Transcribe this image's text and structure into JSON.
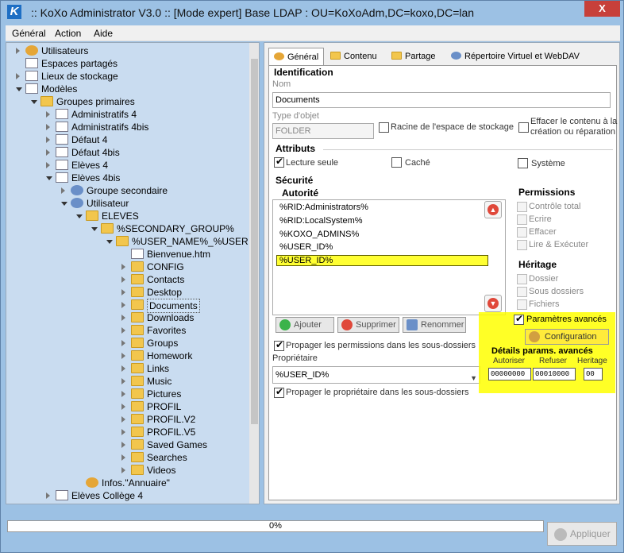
{
  "window": {
    "title": ":: KoXo Administrator V3.0 :: [Mode expert] Base LDAP : OU=KoXoAdm,DC=koxo,DC=lan",
    "close": "X"
  },
  "menu": [
    "Général",
    "Action",
    "Aide"
  ],
  "tree": [
    {
      "label": "Utilisateurs",
      "level": 0,
      "exp": "c",
      "icon": "gear"
    },
    {
      "label": "Espaces partagés",
      "level": 0,
      "exp": "",
      "icon": "doc"
    },
    {
      "label": "Lieux de stockage",
      "level": 0,
      "exp": "c",
      "icon": "doc"
    },
    {
      "label": "Modèles",
      "level": 0,
      "exp": "o",
      "icon": "doc"
    },
    {
      "label": "Groupes primaires",
      "level": 1,
      "exp": "o",
      "icon": "folder"
    },
    {
      "label": "Administratifs 4",
      "level": 2,
      "exp": "c",
      "icon": "doc"
    },
    {
      "label": "Administratifs 4bis",
      "level": 2,
      "exp": "c",
      "icon": "doc"
    },
    {
      "label": "Défaut 4",
      "level": 2,
      "exp": "c",
      "icon": "doc"
    },
    {
      "label": "Défaut 4bis",
      "level": 2,
      "exp": "c",
      "icon": "doc"
    },
    {
      "label": "Elèves 4",
      "level": 2,
      "exp": "c",
      "icon": "doc"
    },
    {
      "label": "Elèves 4bis",
      "level": 2,
      "exp": "o",
      "icon": "doc"
    },
    {
      "label": "Groupe secondaire",
      "level": 3,
      "exp": "c",
      "icon": "user"
    },
    {
      "label": "Utilisateur",
      "level": 3,
      "exp": "o",
      "icon": "user"
    },
    {
      "label": "ELEVES",
      "level": 4,
      "exp": "o",
      "icon": "folder"
    },
    {
      "label": "%SECONDARY_GROUP%",
      "level": 5,
      "exp": "o",
      "icon": "folder"
    },
    {
      "label": "%USER_NAME%_%USER",
      "level": 6,
      "exp": "o",
      "icon": "folder"
    },
    {
      "label": "Bienvenue.htm",
      "level": 7,
      "exp": "",
      "icon": "doc"
    },
    {
      "label": "CONFIG",
      "level": 7,
      "exp": "c",
      "icon": "folder"
    },
    {
      "label": "Contacts",
      "level": 7,
      "exp": "c",
      "icon": "folder"
    },
    {
      "label": "Desktop",
      "level": 7,
      "exp": "c",
      "icon": "folder"
    },
    {
      "label": "Documents",
      "level": 7,
      "exp": "c",
      "icon": "folder",
      "selected": true
    },
    {
      "label": "Downloads",
      "level": 7,
      "exp": "c",
      "icon": "folder"
    },
    {
      "label": "Favorites",
      "level": 7,
      "exp": "c",
      "icon": "folder"
    },
    {
      "label": "Groups",
      "level": 7,
      "exp": "c",
      "icon": "folder"
    },
    {
      "label": "Homework",
      "level": 7,
      "exp": "c",
      "icon": "folder"
    },
    {
      "label": "Links",
      "level": 7,
      "exp": "c",
      "icon": "folder"
    },
    {
      "label": "Music",
      "level": 7,
      "exp": "c",
      "icon": "folder"
    },
    {
      "label": "Pictures",
      "level": 7,
      "exp": "c",
      "icon": "folder"
    },
    {
      "label": "PROFIL",
      "level": 7,
      "exp": "c",
      "icon": "folder"
    },
    {
      "label": "PROFIL.V2",
      "level": 7,
      "exp": "c",
      "icon": "folder"
    },
    {
      "label": "PROFIL.V5",
      "level": 7,
      "exp": "c",
      "icon": "folder"
    },
    {
      "label": "Saved Games",
      "level": 7,
      "exp": "c",
      "icon": "folder"
    },
    {
      "label": "Searches",
      "level": 7,
      "exp": "c",
      "icon": "folder"
    },
    {
      "label": "Videos",
      "level": 7,
      "exp": "c",
      "icon": "folder"
    },
    {
      "label": "Infos.\"Annuaire\"",
      "level": 4,
      "exp": "",
      "icon": "gear"
    },
    {
      "label": "Elèves Collège 4",
      "level": 2,
      "exp": "c",
      "icon": "doc"
    }
  ],
  "tabs": [
    "Général",
    "Contenu",
    "Partage",
    "Répertoire Virtuel et WebDAV"
  ],
  "identification": {
    "heading": "Identification",
    "nom_label": "Nom",
    "nom_value": "Documents",
    "type_label": "Type d'objet",
    "type_value": "FOLDER",
    "racine": "Racine de l'espace de stockage",
    "effacer": "Effacer le contenu à la création ou réparation"
  },
  "attributs": {
    "heading": "Attributs",
    "lecture": "Lecture seule",
    "cache": "Caché",
    "systeme": "Système"
  },
  "securite": {
    "heading": "Sécurité",
    "autorite": "Autorité",
    "entries": [
      "%RID:Administrators%",
      "%RID:LocalSystem%",
      "%KOXO_ADMINS%",
      "%USER_ID%",
      "%USER_ID%"
    ],
    "ajouter": "Ajouter",
    "supprimer": "Supprimer",
    "renommer": "Renommer",
    "propager_perm": "Propager les permissions dans les sous-dossiers",
    "proprietaire_label": "Propriétaire",
    "proprietaire_value": "%USER_ID%",
    "propager_prop": "Propager le propriétaire dans les sous-dossiers"
  },
  "permissions": {
    "heading": "Permissions",
    "items": [
      "Contrôle total",
      "Ecrire",
      "Effacer",
      "Lire & Exécuter"
    ]
  },
  "heritage": {
    "heading": "Héritage",
    "items": [
      "Dossier",
      "Sous dossiers",
      "Fichiers"
    ]
  },
  "avances": {
    "checkbox": "Paramètres avancés",
    "config": "Configuration",
    "heading": "Détails params. avancés",
    "cols": [
      "Autoriser",
      "Refuser",
      "Heritage"
    ],
    "vals": [
      "00000000",
      "00010000",
      "00"
    ]
  },
  "status": {
    "progress": "0%",
    "apply": "Appliquer"
  },
  "colors": {
    "highlight": "#ffff00",
    "tree_bg": "#c9dcf0",
    "chrome": "#9cc1e4"
  }
}
